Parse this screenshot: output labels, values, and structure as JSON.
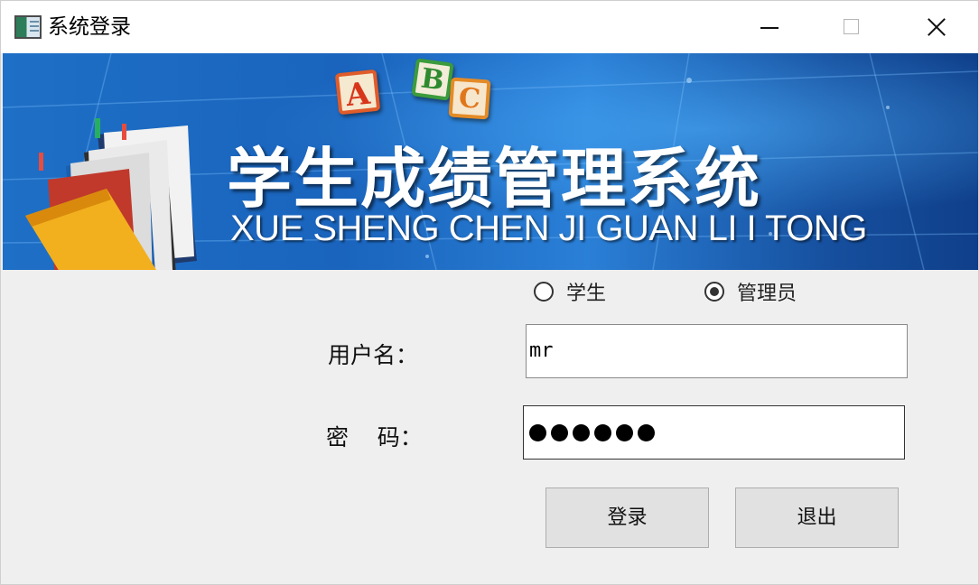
{
  "window": {
    "title": "系统登录"
  },
  "banner": {
    "blocks": [
      "A",
      "B",
      "C"
    ],
    "title_cn": "学生成绩管理系统",
    "title_pinyin": "XUE SHENG CHEN JI GUAN LI I TONG"
  },
  "form": {
    "role_options": [
      {
        "label": "学生",
        "checked": false
      },
      {
        "label": "管理员",
        "checked": true
      }
    ],
    "username_label": "用户名：",
    "username_value": "mr",
    "password_label": "密    码：",
    "password_length": 6,
    "login_label": "登录",
    "exit_label": "退出"
  }
}
